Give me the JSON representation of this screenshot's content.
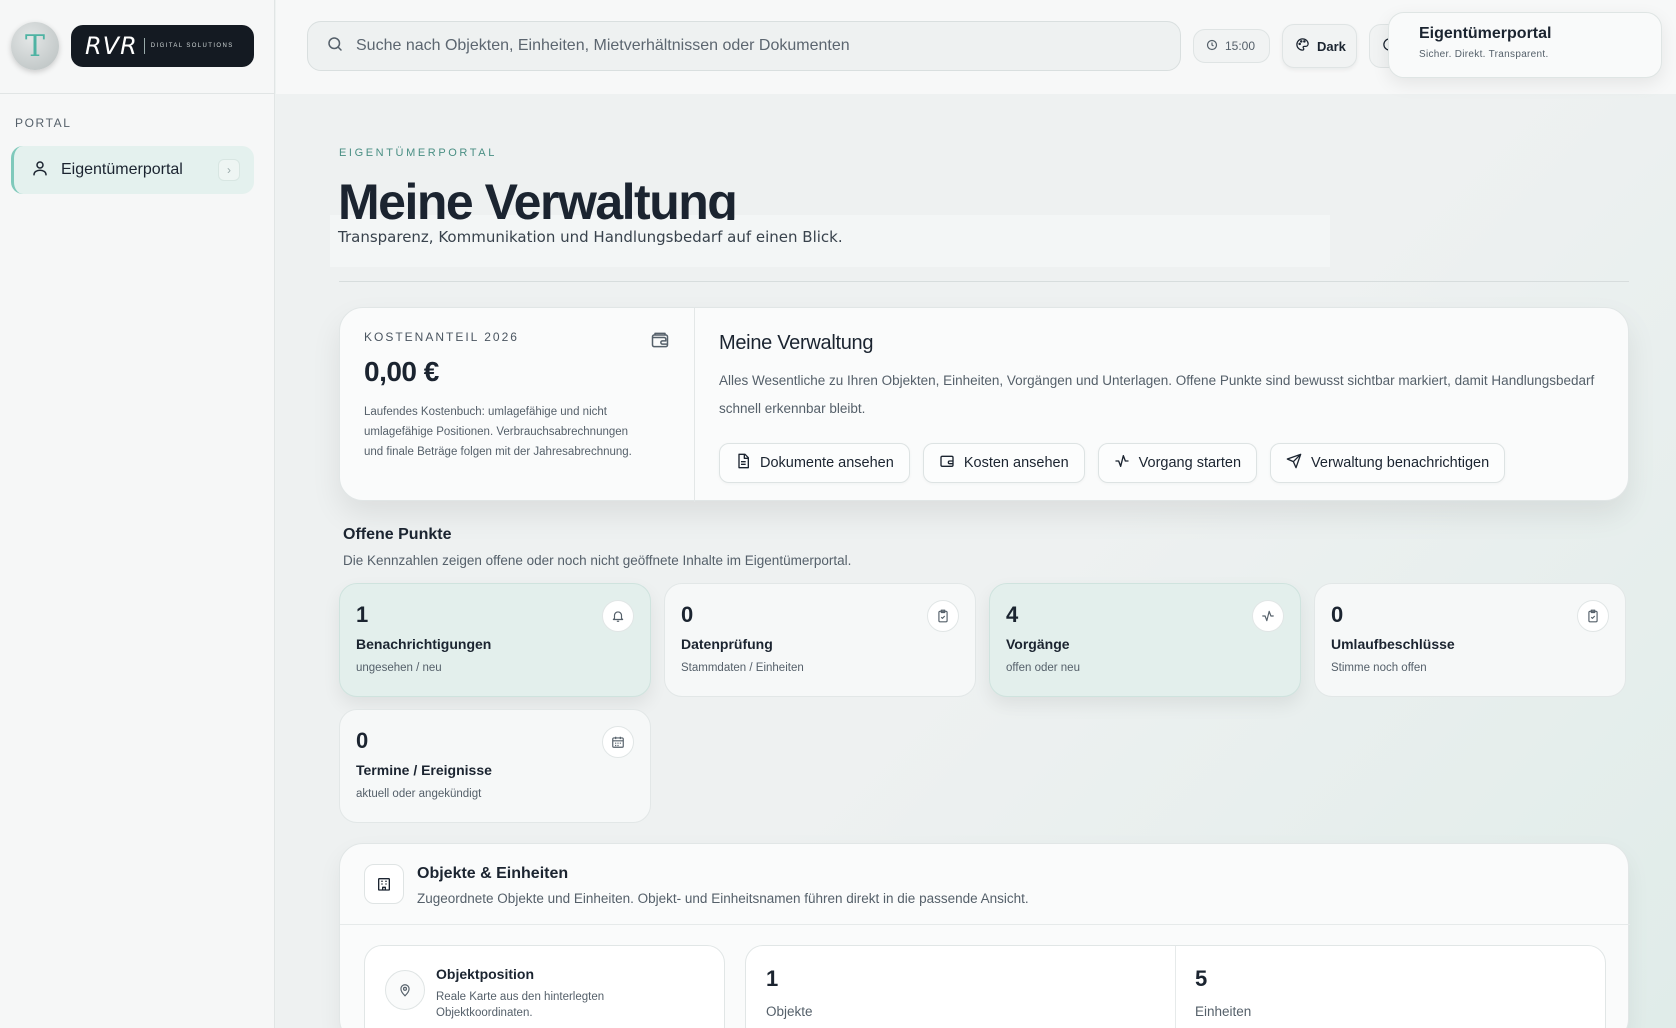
{
  "sidebar": {
    "avatar_letter": "T",
    "logo_mark": "RVR",
    "logo_sub": "DIGITAL SOLUTIONS",
    "section": "PORTAL",
    "items": [
      {
        "label": "Eigentümerportal",
        "icon": "user-icon"
      }
    ]
  },
  "topbar": {
    "search_placeholder": "Suche nach Objekten, Einheiten, Mietverhältnissen oder Dokumenten",
    "time": "15:00",
    "theme_label": "Dark",
    "portal_title": "Eigentümerportal",
    "portal_tagline": "Sicher. Direkt. Transparent."
  },
  "page": {
    "eyebrow": "EIGENTÜMERPORTAL",
    "title": "Meine Verwaltung",
    "subtitle": "Transparenz, Kommunikation und Handlungsbedarf auf einen Blick."
  },
  "hero": {
    "kpi_label": "KOSTENANTEIL 2026",
    "kpi_value": "0,00 €",
    "kpi_desc": "Laufendes Kostenbuch: umlagefähige und nicht umlagefähige Positionen. Verbrauchsabrechnungen und finale Beträge folgen mit der Jahresabrechnung.",
    "title": "Meine Verwaltung",
    "text": "Alles Wesentliche zu Ihren Objekten, Einheiten, Vorgängen und Unterlagen. Offene Punkte sind bewusst sichtbar markiert, damit Handlungsbedarf schnell erkennbar bleibt.",
    "buttons": [
      {
        "label": "Dokumente ansehen",
        "icon": "document-icon"
      },
      {
        "label": "Kosten ansehen",
        "icon": "wallet-icon"
      },
      {
        "label": "Vorgang starten",
        "icon": "activity-icon"
      },
      {
        "label": "Verwaltung benachrichtigen",
        "icon": "send-icon"
      }
    ]
  },
  "open_items": {
    "title": "Offene Punkte",
    "subtitle": "Die Kennzahlen zeigen offene oder noch nicht geöffnete Inhalte im Eigentümerportal.",
    "cards": [
      {
        "value": "1",
        "label": "Benachrichtigungen",
        "caption": "ungesehen / neu",
        "icon": "bell-icon"
      },
      {
        "value": "0",
        "label": "Datenprüfung",
        "caption": "Stammdaten / Einheiten",
        "icon": "clipboard-icon"
      },
      {
        "value": "4",
        "label": "Vorgänge",
        "caption": "offen oder neu",
        "icon": "activity-icon"
      },
      {
        "value": "0",
        "label": "Umlaufbeschlüsse",
        "caption": "Stimme noch offen",
        "icon": "clipboard-icon"
      },
      {
        "value": "0",
        "label": "Termine / Ereignisse",
        "caption": "aktuell oder angekündigt",
        "icon": "calendar-icon"
      }
    ]
  },
  "objects": {
    "title": "Objekte & Einheiten",
    "subtitle": "Zugeordnete Objekte und Einheiten. Objekt- und Einheitsnamen führen direkt in die passende Ansicht.",
    "position_title": "Objektposition",
    "position_desc": "Reale Karte aus den hinterlegten Objektkoordinaten.",
    "stats": [
      {
        "value": "1",
        "label": "Objekte"
      },
      {
        "value": "5",
        "label": "Einheiten"
      }
    ]
  }
}
